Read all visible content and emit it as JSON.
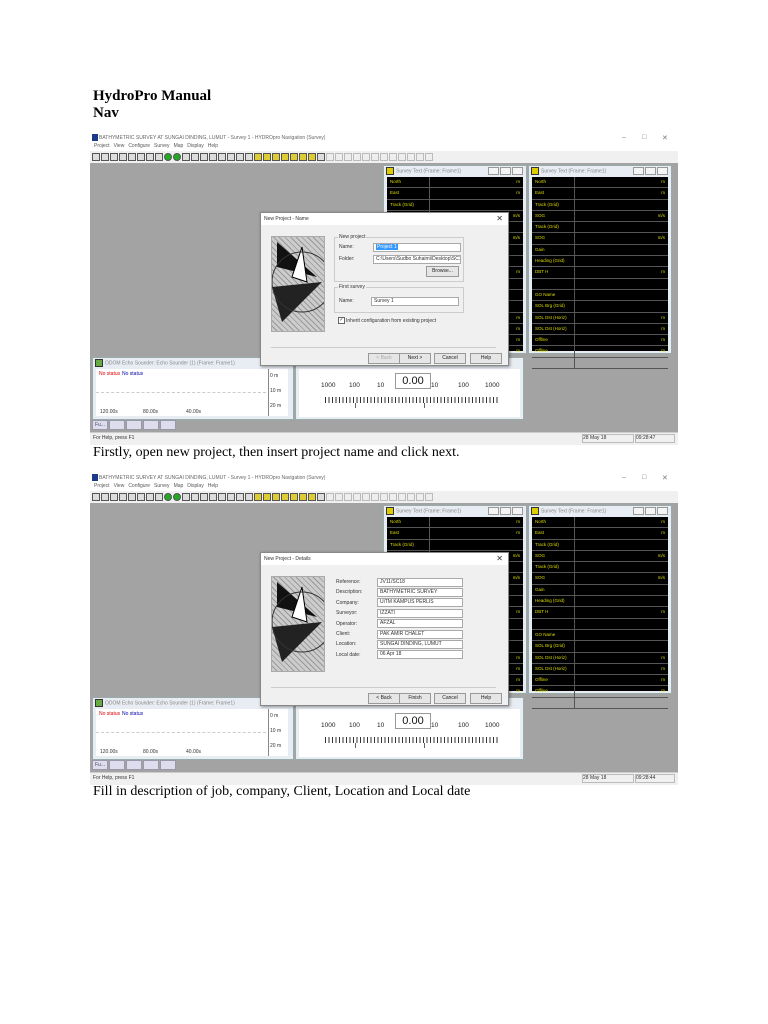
{
  "doc": {
    "title": "HydroPro Manual",
    "subtitle": "Nav",
    "caption1": "Firstly, open new project, then insert project name and click next.",
    "caption2": "Fill in description of job, company, Client, Location and Local date"
  },
  "app": {
    "title": "BATHYMETRIC SURVEY AT SUNGAI DINDING, LUMUT - Survey 1 - HYDROpro Navigation (Survey)",
    "menu": [
      "Project",
      "View",
      "Configure",
      "Survey",
      "Map",
      "Display",
      "Help"
    ],
    "survey_text_title_1": "Survey Text (Frame: Frame1)",
    "survey_text_title_2": "Survey Text (Frame: Frame1)",
    "panel1_rows": [
      {
        "l": "North",
        "u": "m"
      },
      {
        "l": "East",
        "u": "m"
      },
      {
        "l": "Track (Grid)",
        "u": ""
      },
      {
        "l": "SOG",
        "u": "m/s"
      },
      {
        "l": "",
        "u": ""
      },
      {
        "l": "",
        "u": "m/s"
      },
      {
        "l": "",
        "u": ""
      },
      {
        "l": "",
        "u": ""
      },
      {
        "l": "",
        "u": "m"
      },
      {
        "l": "",
        "u": ""
      },
      {
        "l": "",
        "u": ""
      },
      {
        "l": "",
        "u": ""
      },
      {
        "l": "",
        "u": "m"
      },
      {
        "l": "",
        "u": "m"
      },
      {
        "l": "",
        "u": "m"
      },
      {
        "l": "",
        "u": "m"
      },
      {
        "l": "",
        "u": ""
      }
    ],
    "panel2_rows": [
      {
        "l": "North",
        "u": "m"
      },
      {
        "l": "East",
        "u": "m"
      },
      {
        "l": "Track (Grid)",
        "u": ""
      },
      {
        "l": "SOG",
        "u": "m/s"
      },
      {
        "l": "Track (Grid)",
        "u": ""
      },
      {
        "l": "SOG",
        "u": "m/s"
      },
      {
        "l": "Gain",
        "u": ""
      },
      {
        "l": "Heading (Grid)",
        "u": ""
      },
      {
        "l": "DBT H",
        "u": "m"
      },
      {
        "l": "",
        "u": ""
      },
      {
        "l": "GO Name",
        "u": ""
      },
      {
        "l": "SOL Brg (Grid)",
        "u": ""
      },
      {
        "l": "SOL Dst (Horiz)",
        "u": "m"
      },
      {
        "l": "SOL Dst (Horiz)",
        "u": "m"
      },
      {
        "l": "Offline",
        "u": "m"
      },
      {
        "l": "Offline",
        "u": "m"
      },
      {
        "l": "",
        "u": ""
      }
    ],
    "echo_title": "ODOM Echo Sounder: Echo Sounder (1) (Frame: Frame1)",
    "echo_status": [
      "No status",
      "No status"
    ],
    "echo_depths": [
      "0 m",
      "10 m",
      "20 m"
    ],
    "echo_times": [
      "120.00s",
      "80.00s",
      "40.00s"
    ],
    "gauge_left": [
      "1000",
      "100",
      "10"
    ],
    "gauge_value": "0.00",
    "gauge_right": [
      "10",
      "100",
      "1000"
    ],
    "tabs": [
      "Fu...",
      "",
      "",
      "",
      ""
    ],
    "status_help": "For Help, press F1",
    "date": "28 May 18"
  },
  "screens": [
    {
      "time": "09:28:47",
      "dialog": {
        "title": "New Project - Name",
        "type": "name",
        "group1": "New project",
        "name_label": "Name:",
        "name_value": "Project 1",
        "folder_label": "Folder:",
        "folder_value": "C:\\Users\\Sudbo Suhaimi\\Desktop\\SC18",
        "browse": "Browse...",
        "group2": "First survey",
        "survey_label": "Name:",
        "survey_value": "Survey 1",
        "checkbox": "Inherit configuration from existing project",
        "checked": true,
        "buttons": [
          "< Back",
          "Next >",
          "Cancel",
          "Help"
        ]
      }
    },
    {
      "time": "09:28:44",
      "dialog": {
        "title": "New Project - Details",
        "type": "details",
        "fields": [
          {
            "l": "Reference:",
            "v": "JV11/SC18"
          },
          {
            "l": "Description:",
            "v": "BATHYMETRIC SURVEY"
          },
          {
            "l": "Company:",
            "v": "UiTM KAMPUS PERLIS"
          },
          {
            "l": "Surveyor:",
            "v": "IZZATI"
          },
          {
            "l": "Operator:",
            "v": "AFZAL"
          },
          {
            "l": "Client:",
            "v": "PAK AMIR CHALET"
          },
          {
            "l": "Location:",
            "v": "SUNGAI DINDING, LUMUT"
          },
          {
            "l": "Local date:",
            "v": "06 Apr 18"
          }
        ],
        "buttons": [
          "< Back",
          "Finish",
          "Cancel",
          "Help"
        ]
      }
    }
  ]
}
